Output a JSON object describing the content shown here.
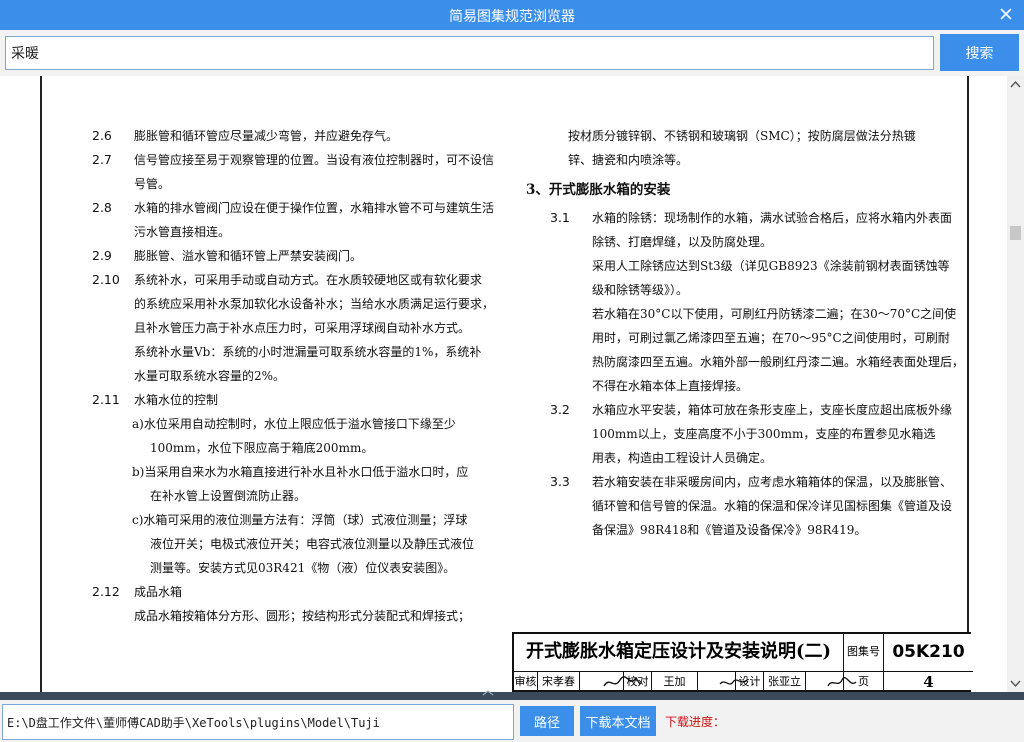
{
  "app": {
    "title": "简易图集规范浏览器"
  },
  "search": {
    "value": "采暖",
    "button_label": "搜索"
  },
  "document": {
    "left": [
      {
        "num": "2.6",
        "lines": [
          "膨胀管和循环管应尽量减少弯管，并应避免存气。"
        ]
      },
      {
        "num": "2.7",
        "lines": [
          "信号管应接至易于观察管理的位置。当设有液位控制器时，可不设信",
          "号管。"
        ]
      },
      {
        "num": "2.8",
        "lines": [
          "水箱的排水管阀门应设在便于操作位置，水箱排水管不可与建筑生活",
          "污水管直接相连。"
        ]
      },
      {
        "num": "2.9",
        "lines": [
          "膨胀管、溢水管和循环管上严禁安装阀门。"
        ]
      },
      {
        "num": "2.10",
        "lines": [
          "系统补水，可采用手动或自动方式。在水质较硬地区或有软化要求",
          "的系统应采用补水泵加软化水设备补水；当给水水质满足运行要求，",
          "且补水管压力高于补水点压力时，可采用浮球阀自动补水方式。",
          "系统补水量Vb：系统的小时泄漏量可取系统水容量的1%，系统补",
          "水量可取系统水容量的2%。"
        ]
      },
      {
        "num": "2.11",
        "lines": [
          "水箱水位的控制"
        ]
      },
      {
        "num": "",
        "sub": [
          "a)水位采用自动控制时，水位上限应低于溢水管接口下缘至少",
          "100mm，水位下限应高于箱底200mm。"
        ]
      },
      {
        "num": "",
        "sub": [
          "b)当采用自来水为水箱直接进行补水且补水口低于溢水口时，应",
          "在补水管上设置倒流防止器。"
        ]
      },
      {
        "num": "",
        "sub": [
          "c)水箱可采用的液位测量方法有：浮筒（球）式液位测量；浮球",
          "液位开关；电极式液位开关；电容式液位测量以及静压式液位",
          "测量等。安装方式见03R421《物（液）位仪表安装图》。"
        ]
      },
      {
        "num": "2.12",
        "lines": [
          "成品水箱",
          "成品水箱按箱体分方形、圆形；按结构形式分装配式和焊接式；"
        ]
      }
    ],
    "right_top": [
      "按材质分镀锌钢、不锈钢和玻璃钢（SMC）；按防腐层做法分热镀",
      "锌、搪瓷和内喷涂等。"
    ],
    "section_heading": "3、开式膨胀水箱的安装",
    "right": [
      {
        "num": "3.1",
        "lines": [
          "水箱的除锈：现场制作的水箱，满水试验合格后，应将水箱内外表面",
          "除锈、打磨焊缝，以及防腐处理。",
          "采用人工除锈应达到St3级（详见GB8923《涂装前钢材表面锈蚀等",
          "级和除锈等级》）。",
          "若水箱在30°C以下使用，可刷红丹防锈漆二遍；在30～70°C之间使",
          "用时，可刷过氯乙烯漆四至五遍；在70～95°C之间使用时，可刷耐",
          "热防腐漆四至五遍。水箱外部一般刷红丹漆二遍。水箱经表面处理后，",
          "不得在水箱本体上直接焊接。"
        ]
      },
      {
        "num": "3.2",
        "lines": [
          "水箱应水平安装，箱体可放在条形支座上，支座长度应超出底板外缘",
          "100mm以上，支座高度不小于300mm，支座的布置参见水箱选",
          "用表，构造由工程设计人员确定。"
        ]
      },
      {
        "num": "3.3",
        "lines": [
          "若水箱安装在非采暖房间内，应考虑水箱箱体的保温，以及膨胀管、",
          "循环管和信号管的保温。水箱的保温和保冷详见国标图集《管道及设",
          "备保温》98R418和《管道及设备保冷》98R419。"
        ]
      }
    ],
    "titleblock": {
      "title": "开式膨胀水箱定压设计及安装说明(二)",
      "atlas_label": "图集号",
      "atlas_no": "05K210",
      "review_label": "审核",
      "review_name": "宋孝春",
      "check_label": "校对",
      "check_name": "王加",
      "design_label": "设计",
      "design_name": "张亚立",
      "page_label": "页",
      "page_no": "4"
    }
  },
  "bottom": {
    "path_value": "E:\\D盘工作文件\\董师傅CAD助手\\XeTools\\plugins\\Model\\Tuji",
    "path_button": "路径",
    "download_button": "下载本文档",
    "progress_label": "下载进度："
  },
  "colors": {
    "accent": "#3b8fea",
    "progress_text": "#d01010"
  }
}
